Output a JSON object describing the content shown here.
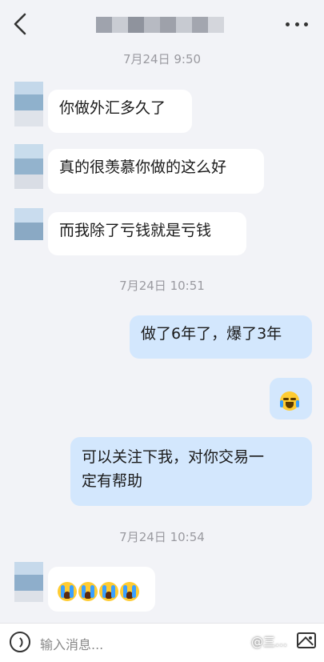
{
  "header": {
    "back_icon": "chevron-left-icon",
    "more_icon": "more-horizontal-icon"
  },
  "timestamps": [
    "7月24日 9:50",
    "7月24日 10:51",
    "7月24日 10:54"
  ],
  "messages": [
    {
      "from": "other",
      "text": "你做外汇多久了"
    },
    {
      "from": "other",
      "text": "真的很羡慕你做的这么好"
    },
    {
      "from": "other",
      "text": "而我除了亏钱就是亏钱"
    },
    {
      "from": "me",
      "text": "做了6年了，爆了3年"
    },
    {
      "from": "me",
      "emoji": "laugh-with-tears-emoji"
    },
    {
      "from": "me",
      "lines": [
        "可以关注下我，对你交易一",
        "定有帮助"
      ]
    },
    {
      "from": "other",
      "emoji": "crying-emoji",
      "count": 4
    }
  ],
  "input": {
    "placeholder": "输入消息...",
    "voice_icon": "voice-icon",
    "image_icon": "image-icon"
  },
  "watermark": "@三…",
  "colors": {
    "background": "#f2f3f7",
    "incoming_bubble": "#ffffff",
    "outgoing_bubble": "#d3e7fd",
    "timestamp": "#9a9aa0"
  }
}
